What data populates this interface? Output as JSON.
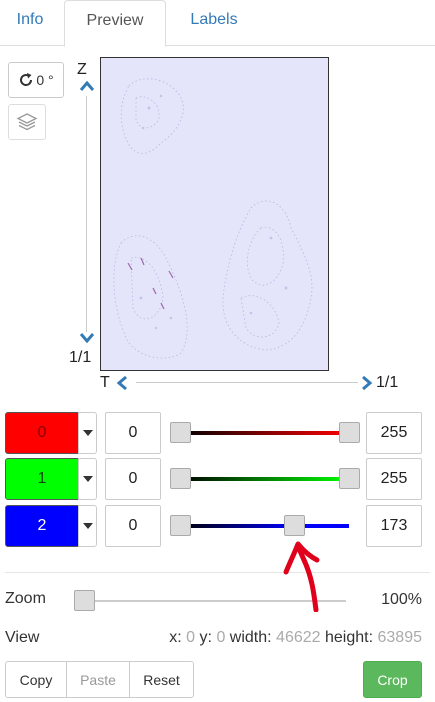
{
  "tabs": [
    {
      "label": "Info"
    },
    {
      "label": "Preview"
    },
    {
      "label": "Labels"
    }
  ],
  "toolbar": {
    "rotation_label": "0 °",
    "rotate_icon": "rotate-icon",
    "layers_icon": "layers-icon"
  },
  "z_axis": {
    "label": "Z",
    "value": "1/1"
  },
  "t_axis": {
    "label": "T",
    "value": "1/1"
  },
  "channels": [
    {
      "label": "0",
      "color": "#ff0000",
      "min": "0",
      "max": "255",
      "min_fraction": 0.0,
      "max_fraction": 1.0
    },
    {
      "label": "1",
      "color": "#00ff00",
      "min": "0",
      "max": "255",
      "min_fraction": 0.0,
      "max_fraction": 1.0
    },
    {
      "label": "2",
      "color": "#0000ff",
      "min": "0",
      "max": "173",
      "min_fraction": 0.0,
      "max_fraction": 0.678
    }
  ],
  "zoom": {
    "label": "Zoom",
    "value": "100%",
    "fraction": 0.0
  },
  "view": {
    "label": "View",
    "x_label": "x:",
    "x": "0",
    "y_label": "y:",
    "y": "0",
    "width_label": "width:",
    "width": "46622",
    "height_label": "height:",
    "height": "63895"
  },
  "buttons": {
    "copy": "Copy",
    "paste": "Paste",
    "reset": "Reset",
    "crop": "Crop"
  },
  "colors": {
    "link": "#337ab7",
    "crop": "#5cb85c",
    "annotation": "#e0001b"
  }
}
